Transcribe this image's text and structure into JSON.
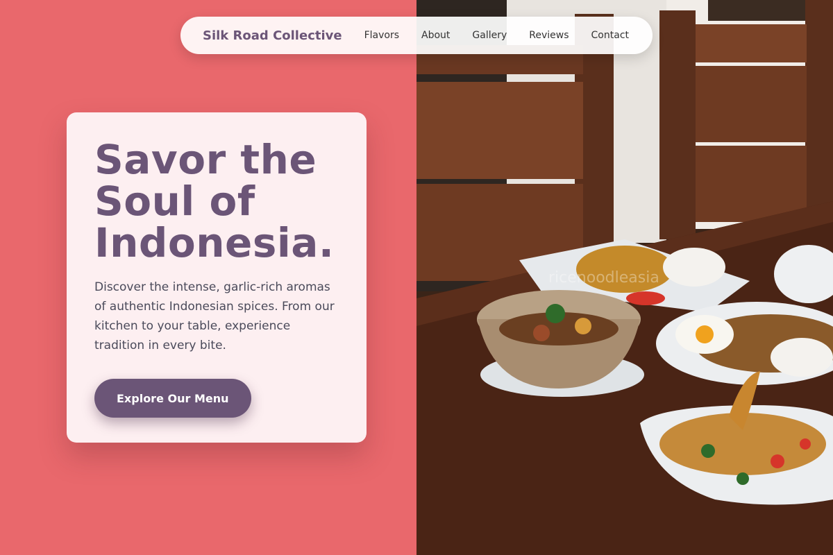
{
  "nav": {
    "brand": "Silk Road Collective",
    "links": [
      {
        "label": "Flavors"
      },
      {
        "label": "About"
      },
      {
        "label": "Gallery"
      },
      {
        "label": "Reviews"
      },
      {
        "label": "Contact"
      }
    ]
  },
  "hero": {
    "title_line1": "Savor the",
    "title_line2": "Soul of",
    "title_line3": "Indonesia.",
    "description": "Discover the intense, garlic-rich aromas of authentic Indonesian spices. From our kitchen to your table, experience tradition in every bite.",
    "cta_label": "Explore Our Menu"
  },
  "photo": {
    "watermark": "ricenoodleasia"
  },
  "colors": {
    "accent": "#6b5577",
    "left_background": "#e9686c",
    "card_background": "#fdeff1"
  }
}
